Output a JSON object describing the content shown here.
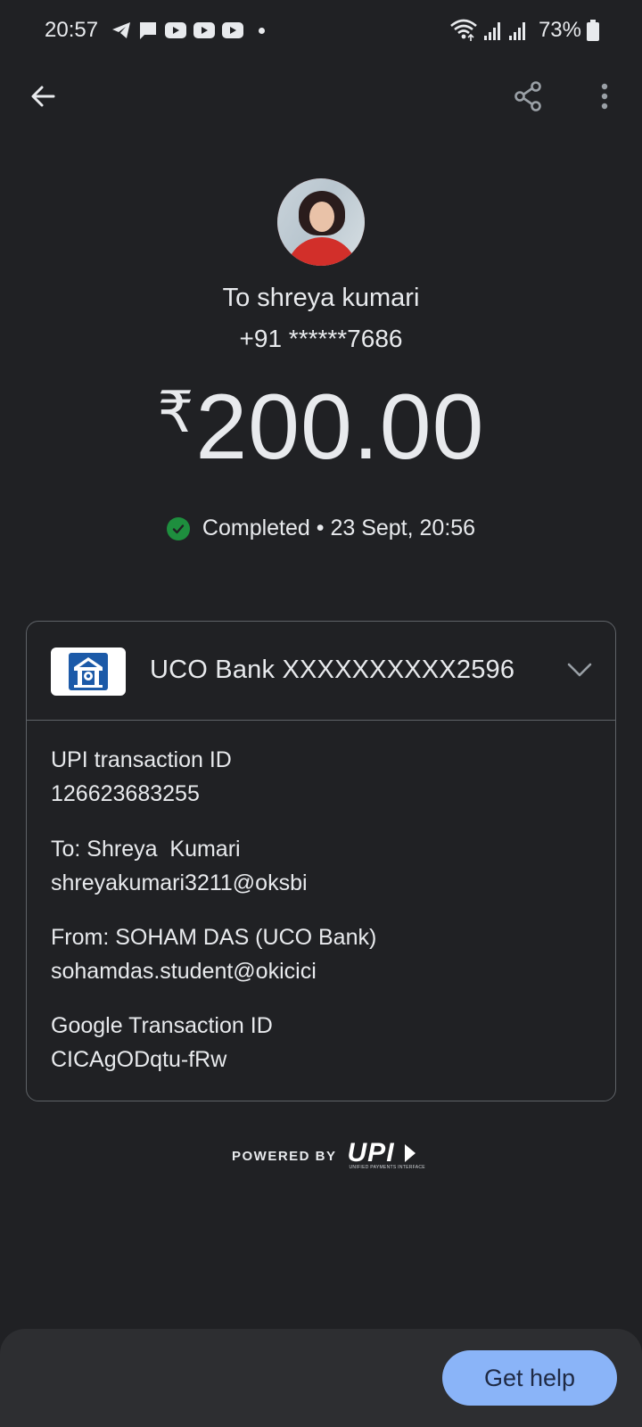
{
  "status_bar": {
    "time": "20:57",
    "battery": "73%",
    "icons": [
      "telegram-icon",
      "chat-icon",
      "youtube-icon",
      "youtube-icon",
      "youtube-icon",
      "dot-icon",
      "wifi-icon",
      "signal-icon",
      "signal-icon",
      "battery-icon"
    ]
  },
  "app_bar": {
    "back_icon": "arrow-back-icon",
    "share_icon": "share-icon",
    "more_icon": "more-vert-icon"
  },
  "recipient": {
    "name": "To shreya kumari",
    "phone": "+91 ******7686"
  },
  "payment": {
    "currency": "₹",
    "amount": "200.00",
    "status_text": "Completed • 23 Sept, 20:56",
    "status_color": "#1e8e3e"
  },
  "card": {
    "bank_account": "UCO Bank XXXXXXXXXX2596",
    "details": [
      {
        "label": "UPI transaction ID",
        "value": "126623683255"
      },
      {
        "label": "To: Shreya  Kumari",
        "value": "shreyakumari3211@oksbi"
      },
      {
        "label": "From: SOHAM DAS (UCO Bank)",
        "value": "sohamdas.student@okicici"
      },
      {
        "label": "Google Transaction ID",
        "value": "CICAgODqtu-fRw"
      }
    ]
  },
  "footer": {
    "powered_by": "POWERED BY",
    "upi_word": "UPI",
    "upi_sub": "UNIFIED PAYMENTS INTERFACE"
  },
  "bottom": {
    "help_label": "Get help",
    "accent": "#8ab4f8"
  }
}
